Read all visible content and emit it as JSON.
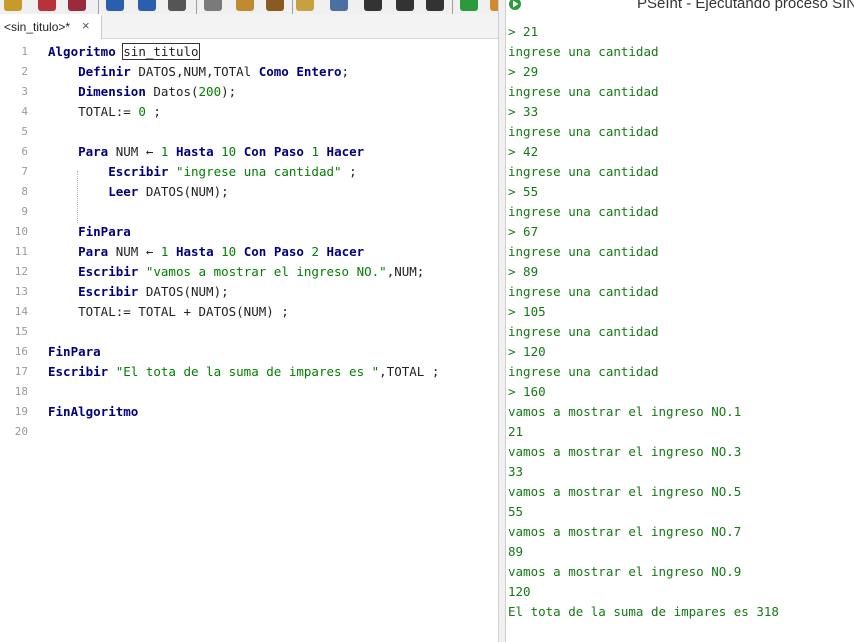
{
  "editor": {
    "tab_label": "<sin_titulo>*",
    "tab_close": "×",
    "lines": [
      {
        "n": "1",
        "tokens": [
          {
            "t": "kw",
            "v": "Algoritmo"
          },
          {
            "t": "id",
            "v": " "
          },
          {
            "t": "name",
            "v": "sin_titulo"
          }
        ]
      },
      {
        "n": "2",
        "tokens": [
          {
            "t": "id",
            "v": "    "
          },
          {
            "t": "kw",
            "v": "Definir"
          },
          {
            "t": "id",
            "v": " DATOS,NUM,TOTAl "
          },
          {
            "t": "kw",
            "v": "Como Entero"
          },
          {
            "t": "id",
            "v": ";"
          }
        ]
      },
      {
        "n": "3",
        "tokens": [
          {
            "t": "id",
            "v": "    "
          },
          {
            "t": "kw",
            "v": "Dimension"
          },
          {
            "t": "id",
            "v": " Datos("
          },
          {
            "t": "num",
            "v": "200"
          },
          {
            "t": "id",
            "v": ");"
          }
        ]
      },
      {
        "n": "4",
        "tokens": [
          {
            "t": "id",
            "v": "    TOTAL:= "
          },
          {
            "t": "num",
            "v": "0"
          },
          {
            "t": "id",
            "v": " ;"
          }
        ]
      },
      {
        "n": "5",
        "tokens": []
      },
      {
        "n": "6",
        "tokens": [
          {
            "t": "id",
            "v": "    "
          },
          {
            "t": "kw",
            "v": "Para"
          },
          {
            "t": "id",
            "v": " NUM ← "
          },
          {
            "t": "num",
            "v": "1"
          },
          {
            "t": "id",
            "v": " "
          },
          {
            "t": "kw",
            "v": "Hasta"
          },
          {
            "t": "id",
            "v": " "
          },
          {
            "t": "num",
            "v": "10"
          },
          {
            "t": "id",
            "v": " "
          },
          {
            "t": "kw",
            "v": "Con Paso"
          },
          {
            "t": "id",
            "v": " "
          },
          {
            "t": "num",
            "v": "1"
          },
          {
            "t": "id",
            "v": " "
          },
          {
            "t": "kw",
            "v": "Hacer"
          }
        ]
      },
      {
        "n": "7",
        "tokens": [
          {
            "t": "id",
            "v": "        "
          },
          {
            "t": "kw",
            "v": "Escribir"
          },
          {
            "t": "id",
            "v": " "
          },
          {
            "t": "str",
            "v": "\"ingrese una cantidad\""
          },
          {
            "t": "id",
            "v": " ;"
          }
        ]
      },
      {
        "n": "8",
        "tokens": [
          {
            "t": "id",
            "v": "        "
          },
          {
            "t": "kw",
            "v": "Leer"
          },
          {
            "t": "id",
            "v": " DATOS(NUM);"
          }
        ]
      },
      {
        "n": "9",
        "tokens": []
      },
      {
        "n": "10",
        "tokens": [
          {
            "t": "id",
            "v": "    "
          },
          {
            "t": "kw",
            "v": "FinPara"
          }
        ]
      },
      {
        "n": "11",
        "tokens": [
          {
            "t": "id",
            "v": "    "
          },
          {
            "t": "kw",
            "v": "Para"
          },
          {
            "t": "id",
            "v": " NUM ← "
          },
          {
            "t": "num",
            "v": "1"
          },
          {
            "t": "id",
            "v": " "
          },
          {
            "t": "kw",
            "v": "Hasta"
          },
          {
            "t": "id",
            "v": " "
          },
          {
            "t": "num",
            "v": "10"
          },
          {
            "t": "id",
            "v": " "
          },
          {
            "t": "kw",
            "v": "Con Paso"
          },
          {
            "t": "id",
            "v": " "
          },
          {
            "t": "num",
            "v": "2"
          },
          {
            "t": "id",
            "v": " "
          },
          {
            "t": "kw",
            "v": "Hacer"
          }
        ]
      },
      {
        "n": "12",
        "tokens": [
          {
            "t": "id",
            "v": "    "
          },
          {
            "t": "kw",
            "v": "Escribir"
          },
          {
            "t": "id",
            "v": " "
          },
          {
            "t": "str",
            "v": "\"vamos a mostrar el ingreso NO.\""
          },
          {
            "t": "id",
            "v": ",NUM;"
          }
        ]
      },
      {
        "n": "13",
        "tokens": [
          {
            "t": "id",
            "v": "    "
          },
          {
            "t": "kw",
            "v": "Escribir"
          },
          {
            "t": "id",
            "v": " DATOS(NUM);"
          }
        ]
      },
      {
        "n": "14",
        "tokens": [
          {
            "t": "id",
            "v": "    TOTAL:= TOTAL + DATOS(NUM) ;"
          }
        ]
      },
      {
        "n": "15",
        "tokens": []
      },
      {
        "n": "16",
        "tokens": [
          {
            "t": "kw",
            "v": "FinPara"
          }
        ]
      },
      {
        "n": "17",
        "tokens": [
          {
            "t": "kw",
            "v": "Escribir"
          },
          {
            "t": "id",
            "v": " "
          },
          {
            "t": "str",
            "v": "\"El tota de la suma de impares es \""
          },
          {
            "t": "id",
            "v": ",TOTAL ;"
          }
        ]
      },
      {
        "n": "18",
        "tokens": []
      },
      {
        "n": "19",
        "tokens": [
          {
            "t": "kw",
            "v": "FinAlgoritmo"
          }
        ]
      },
      {
        "n": "20",
        "tokens": []
      }
    ]
  },
  "console": {
    "title": "PSeInt - Ejecutando proceso SIN_",
    "lines": [
      "> 21",
      "ingrese una cantidad",
      "> 29",
      "ingrese una cantidad",
      "> 33",
      "ingrese una cantidad",
      "> 42",
      "ingrese una cantidad",
      "> 55",
      "ingrese una cantidad",
      "> 67",
      "ingrese una cantidad",
      "> 89",
      "ingrese una cantidad",
      "> 105",
      "ingrese una cantidad",
      "> 120",
      "ingrese una cantidad",
      "> 160",
      "vamos a mostrar el ingreso NO.1",
      "21",
      "vamos a mostrar el ingreso NO.3",
      "33",
      "vamos a mostrar el ingreso NO.5",
      "55",
      "vamos a mostrar el ingreso NO.7",
      "89",
      "vamos a mostrar el ingreso NO.9",
      "120",
      "El tota de la suma de impares es 318"
    ]
  },
  "toolbar": {
    "icons": [
      {
        "name": "new-file-icon",
        "color": "#c89a2a"
      },
      {
        "name": "open-file-icon",
        "color": "#b8323a"
      },
      {
        "name": "save-file-icon",
        "color": "#9a2b3c"
      },
      {
        "name": "undo-icon",
        "color": "#2a5fb0"
      },
      {
        "name": "redo-icon",
        "color": "#2a5fb0"
      },
      {
        "name": "cut-icon",
        "color": "#555555"
      },
      {
        "name": "copy-icon",
        "color": "#7a7a7a"
      },
      {
        "name": "paste-icon",
        "color": "#c08a30"
      },
      {
        "name": "indent-icon",
        "color": "#8a5a20"
      },
      {
        "name": "find-icon",
        "color": "#c8a040"
      },
      {
        "name": "replace-icon",
        "color": "#4a6fa0"
      },
      {
        "name": "run-step-icon",
        "color": "#333333"
      },
      {
        "name": "debug-icon",
        "color": "#333333"
      },
      {
        "name": "flowchart-icon",
        "color": "#333333"
      },
      {
        "name": "run-icon",
        "color": "#2a9a3a"
      },
      {
        "name": "help-icon",
        "color": "#d08a30"
      }
    ]
  },
  "colors": {
    "keyword": "#00007f",
    "number": "#007f00",
    "console_text": "#137a13"
  }
}
